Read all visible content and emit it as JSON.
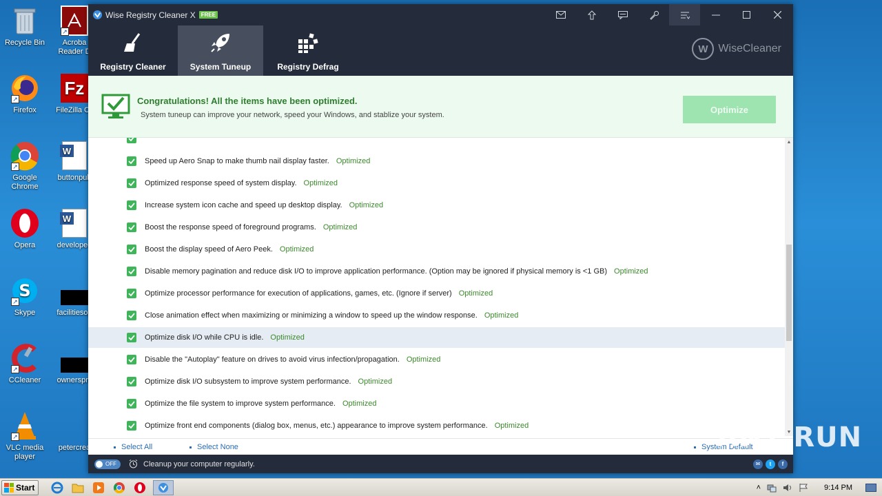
{
  "desktop": {
    "icons": [
      {
        "label": "Recycle Bin"
      },
      {
        "label": "Acroba Reader D"
      },
      {
        "label": "Firefox"
      },
      {
        "label": "FileZilla Cli"
      },
      {
        "label": "Google Chrome"
      },
      {
        "label": "buttonpub"
      },
      {
        "label": "Opera"
      },
      {
        "label": "developed"
      },
      {
        "label": "Skype"
      },
      {
        "label": "facilitiesop"
      },
      {
        "label": "CCleaner"
      },
      {
        "label": "ownerspm"
      },
      {
        "label": "VLC media player"
      },
      {
        "label": "petercrea"
      }
    ]
  },
  "window": {
    "title": "Wise Registry Cleaner X",
    "badge": "FREE",
    "brand": "WiseCleaner",
    "tabs": [
      {
        "label": "Registry Cleaner"
      },
      {
        "label": "System Tuneup"
      },
      {
        "label": "Registry Defrag"
      }
    ]
  },
  "banner": {
    "title": "Congratulations! All the items have been optimized.",
    "subtitle": "System tuneup can improve your network, speed your Windows, and stablize your system.",
    "button": "Optimize"
  },
  "items": [
    {
      "text": "Speed up Aero Snap to make thumb nail display faster.",
      "status": "Optimized"
    },
    {
      "text": "Optimized response speed of system display.",
      "status": "Optimized"
    },
    {
      "text": "Increase system icon cache and speed up desktop display.",
      "status": "Optimized"
    },
    {
      "text": "Boost the response speed of foreground programs.",
      "status": "Optimized"
    },
    {
      "text": "Boost the display speed of Aero Peek.",
      "status": "Optimized"
    },
    {
      "text": "Disable memory pagination and reduce disk I/O to improve application performance. (Option may be ignored if physical memory is <1 GB)",
      "status": "Optimized"
    },
    {
      "text": "Optimize processor performance for execution of applications, games, etc. (Ignore if server)",
      "status": "Optimized"
    },
    {
      "text": "Close animation effect when maximizing or minimizing a window to speed up the window response.",
      "status": "Optimized"
    },
    {
      "text": "Optimize disk I/O while CPU is idle.",
      "status": "Optimized"
    },
    {
      "text": "Disable the \"Autoplay\" feature on drives to avoid virus infection/propagation.",
      "status": "Optimized"
    },
    {
      "text": "Optimize disk I/O subsystem to improve system performance.",
      "status": "Optimized"
    },
    {
      "text": "Optimize the file system to improve system performance.",
      "status": "Optimized"
    },
    {
      "text": "Optimize front end components (dialog box, menus, etc.) appearance to improve system performance.",
      "status": "Optimized"
    }
  ],
  "links": {
    "select_all": "Select All",
    "select_none": "Select None",
    "system_default": "System Default"
  },
  "statusbar": {
    "toggle": "OFF",
    "text": "Cleanup your computer regularly."
  },
  "taskbar": {
    "start": "Start",
    "clock": "9:14 PM"
  },
  "watermark": "ANY RUN",
  "colors": {
    "dark": "#242b3a",
    "accent_green": "#3fb55a",
    "status_green": "#3a8a2a",
    "optimize_button": "#9ee4b1"
  }
}
